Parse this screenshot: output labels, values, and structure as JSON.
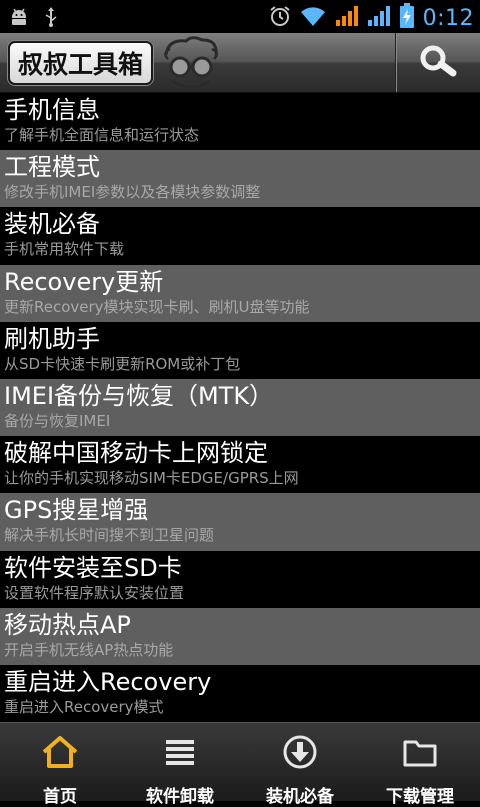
{
  "status_bar": {
    "time": "0:12",
    "icons": [
      "android-debug-icon",
      "usb-icon",
      "alarm-icon",
      "wifi-icon",
      "signal-icon",
      "signal-icon",
      "battery-charging-icon"
    ],
    "time_color": "#5ab7ff"
  },
  "title_bar": {
    "app_title": "叔叔工具箱",
    "search_icon": "search-icon"
  },
  "menu": [
    {
      "title": "手机信息",
      "subtitle": "了解手机全面信息和运行状态"
    },
    {
      "title": "工程模式",
      "subtitle": "修改手机IMEI参数以及各模块参数调整"
    },
    {
      "title": "装机必备",
      "subtitle": "手机常用软件下载"
    },
    {
      "title": "Recovery更新",
      "subtitle": "更新Recovery模块实现卡刷、刷机U盘等功能"
    },
    {
      "title": "刷机助手",
      "subtitle": "从SD卡快速卡刷更新ROM或补丁包"
    },
    {
      "title": "IMEI备份与恢复（MTK）",
      "subtitle": "备份与恢复IMEI"
    },
    {
      "title": "破解中国移动卡上网锁定",
      "subtitle": "让你的手机实现移动SIM卡EDGE/GPRS上网"
    },
    {
      "title": "GPS搜星增强",
      "subtitle": "解决手机长时间搜不到卫星问题"
    },
    {
      "title": "软件安装至SD卡",
      "subtitle": "设置软件程序默认安装位置"
    },
    {
      "title": "移动热点AP",
      "subtitle": "开启手机无线AP热点功能"
    },
    {
      "title": "重启进入Recovery",
      "subtitle": "重启进入Recovery模式"
    }
  ],
  "bottom_nav": [
    {
      "label": "首页",
      "icon": "home-icon",
      "active": true
    },
    {
      "label": "软件卸载",
      "icon": "list-icon"
    },
    {
      "label": "装机必备",
      "icon": "download-circle-icon"
    },
    {
      "label": "下载管理",
      "icon": "folder-icon"
    }
  ],
  "colors": {
    "row_dark": "#000000",
    "row_light": "#5f5f5f",
    "active_icon": "#f0b020"
  }
}
